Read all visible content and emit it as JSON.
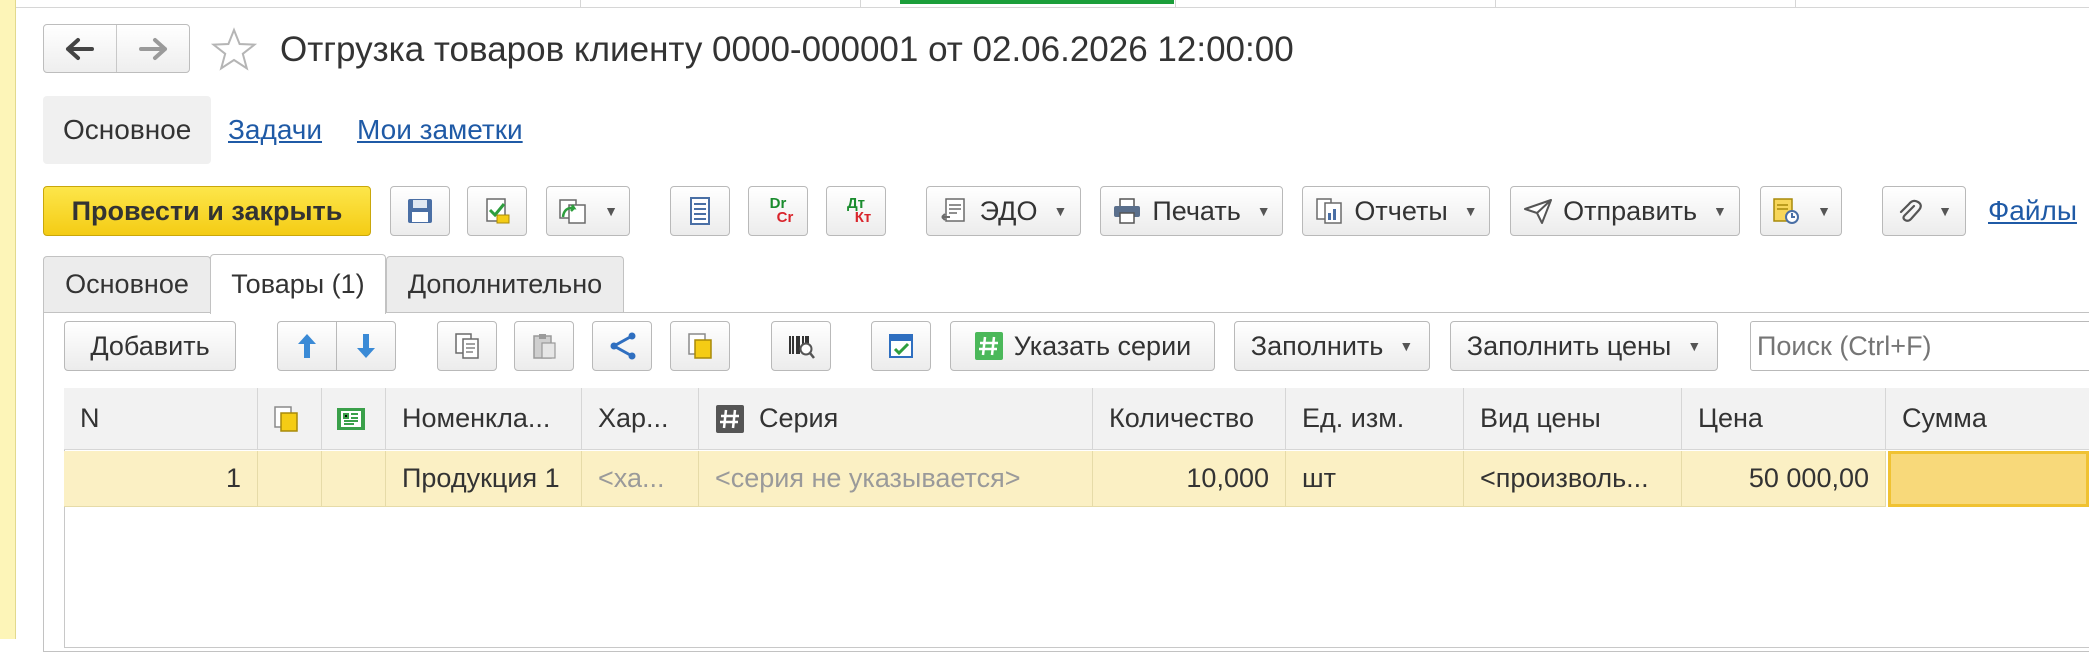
{
  "window": {
    "title": "Отгрузка товаров клиенту 0000-000001 от 02.06.2026 12:00:00"
  },
  "icons": {
    "back": "arrow-left-icon",
    "forward": "arrow-right-icon",
    "favorite": "star-icon"
  },
  "colors": {
    "primary_button": "#f4cc15",
    "row_selected": "#fbf0c4",
    "link": "#1f5aa6",
    "active_top_tab": "#1b9e3a"
  },
  "sections": {
    "main": "Основное",
    "tasks": "Задачи",
    "notes": "Мои заметки"
  },
  "toolbar": {
    "post_close": "Провести и закрыть",
    "edo": "ЭДО",
    "print": "Печать",
    "reports": "Отчеты",
    "send": "Отправить",
    "files": "Файлы",
    "dr": "Dr",
    "cr": "Cr",
    "dt": "Дт",
    "kt": "Кт"
  },
  "tabs": {
    "main": "Основное",
    "goods": "Товары (1)",
    "extra": "Дополнительно"
  },
  "table_toolbar": {
    "add": "Добавить",
    "series": "Указать серии",
    "fill": "Заполнить",
    "fill_prices": "Заполнить цены",
    "search_placeholder": "Поиск (Ctrl+F)"
  },
  "table": {
    "headers": {
      "n": "N",
      "item": "Номенкла...",
      "char": "Хар...",
      "series": "Серия",
      "qty": "Количество",
      "unit": "Ед. изм.",
      "price_type": "Вид цены",
      "price": "Цена",
      "sum": "Сумма"
    },
    "rows": [
      {
        "n": "1",
        "item": "Продукция 1",
        "char": "<ха...",
        "series": "<серия не указывается>",
        "qty": "10,000",
        "unit": "шт",
        "price_type": "<произволь...",
        "price": "50 000,00",
        "sum": ""
      }
    ]
  }
}
